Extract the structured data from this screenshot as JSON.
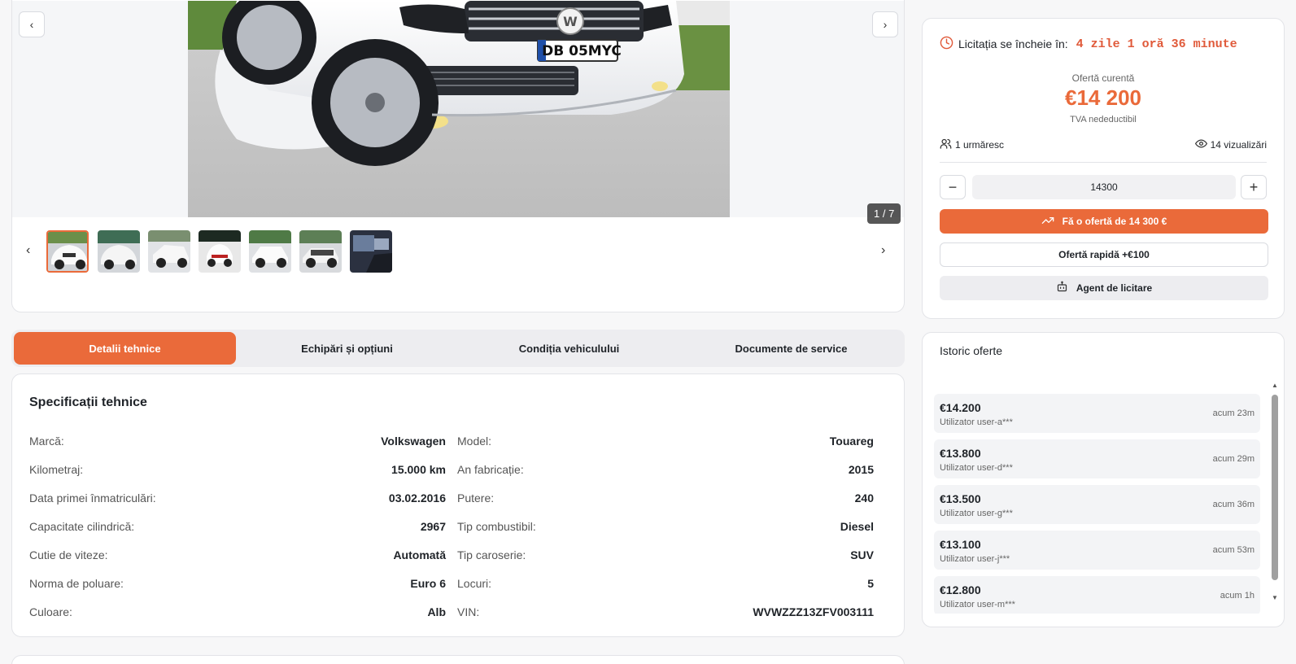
{
  "gallery": {
    "prev_icon": "‹",
    "next_icon": "›",
    "counter": "1 / 7",
    "plate_text": "DB 05MYC",
    "thumb_prev_icon": "‹",
    "thumb_next_icon": "›",
    "thumbnail_count": 7
  },
  "tabs": [
    {
      "label": "Detalii tehnice",
      "active": true
    },
    {
      "label": "Echipări și opțiuni",
      "active": false
    },
    {
      "label": "Condiția vehiculului",
      "active": false
    },
    {
      "label": "Documente de service",
      "active": false
    }
  ],
  "specs": {
    "title": "Specificații tehnice",
    "left": [
      {
        "label": "Marcă:",
        "value": "Volkswagen"
      },
      {
        "label": "Kilometraj:",
        "value": "15.000 km"
      },
      {
        "label": "Data primei înmatriculări:",
        "value": "03.02.2016"
      },
      {
        "label": "Capacitate cilindrică:",
        "value": "2967"
      },
      {
        "label": "Cutie de viteze:",
        "value": "Automată"
      },
      {
        "label": "Norma de poluare:",
        "value": "Euro 6"
      },
      {
        "label": "Culoare:",
        "value": "Alb"
      }
    ],
    "right": [
      {
        "label": "Model:",
        "value": "Touareg"
      },
      {
        "label": "An fabricație:",
        "value": "2015"
      },
      {
        "label": "Putere:",
        "value": "240"
      },
      {
        "label": "Tip combustibil:",
        "value": "Diesel"
      },
      {
        "label": "Tip caroserie:",
        "value": "SUV"
      },
      {
        "label": "Locuri:",
        "value": "5"
      },
      {
        "label": "VIN:",
        "value": "WVWZZZ13ZFV003111"
      }
    ]
  },
  "auction": {
    "timer_label": "Licitația se încheie în:",
    "timer_value": "4 zile 1 oră 36 minute",
    "offer_label": "Ofertă curentă",
    "offer_value": "€14 200",
    "vat_note": "TVA nedeductibil",
    "watchers": "1 urmăresc",
    "views": "14 vizualizări",
    "bid_value": "14300",
    "minus_label": "−",
    "plus_label": "+",
    "place_bid_label": "Fă o ofertă de 14 300 €",
    "quick_bid_label": "Ofertă rapidă +€100",
    "agent_label": "Agent de licitare",
    "accent_color": "#ea6a3a"
  },
  "history": {
    "title": "Istoric oferte",
    "bids": [
      {
        "amount": "€14.200",
        "user": "Utilizator user-a***",
        "time": "acum 23m"
      },
      {
        "amount": "€13.800",
        "user": "Utilizator user-d***",
        "time": "acum 29m"
      },
      {
        "amount": "€13.500",
        "user": "Utilizator user-g***",
        "time": "acum 36m"
      },
      {
        "amount": "€13.100",
        "user": "Utilizator user-j***",
        "time": "acum 53m"
      },
      {
        "amount": "€12.800",
        "user": "Utilizator user-m***",
        "time": "acum 1h"
      }
    ]
  }
}
